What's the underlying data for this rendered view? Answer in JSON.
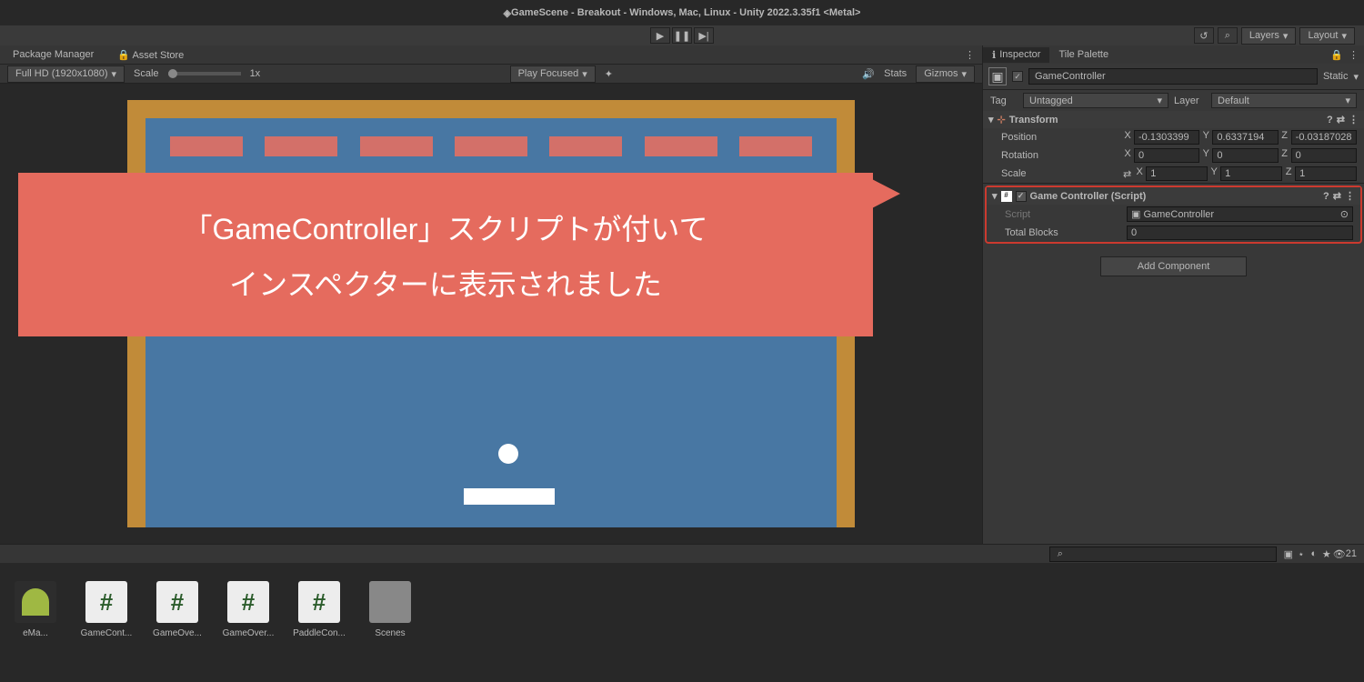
{
  "app": {
    "title": "GameScene - Breakout - Windows, Mac, Linux - Unity 2022.3.35f1 <Metal>"
  },
  "topbar": {
    "layers": "Layers",
    "layout": "Layout"
  },
  "tabs": {
    "package_manager": "Package Manager",
    "asset_store": "Asset Store"
  },
  "scene_toolbar": {
    "resolution": "Full HD (1920x1080)",
    "scale_label": "Scale",
    "scale_value": "1x",
    "play_focused": "Play Focused",
    "stats": "Stats",
    "gizmos": "Gizmos"
  },
  "callout": {
    "line1": "「GameController」スクリプトが付いて",
    "line2": "インスペクターに表示されました"
  },
  "inspector": {
    "tab_inspector": "Inspector",
    "tab_tile_palette": "Tile Palette",
    "object_name": "GameController",
    "static_label": "Static",
    "tag_label": "Tag",
    "tag_value": "Untagged",
    "layer_label": "Layer",
    "layer_value": "Default",
    "transform": {
      "title": "Transform",
      "position_label": "Position",
      "pos_x": "-0.1303399",
      "pos_y": "0.6337194",
      "pos_z": "-0.03187028",
      "rotation_label": "Rotation",
      "rot_x": "0",
      "rot_y": "0",
      "rot_z": "0",
      "scale_label": "Scale",
      "scl_x": "1",
      "scl_y": "1",
      "scl_z": "1"
    },
    "script_comp": {
      "title": "Game Controller (Script)",
      "script_label": "Script",
      "script_value": "GameController",
      "total_blocks_label": "Total Blocks",
      "total_blocks_value": "0"
    },
    "add_component": "Add Component"
  },
  "project": {
    "items": [
      "eMa...",
      "GameCont...",
      "GameOve...",
      "GameOver...",
      "PaddleCon...",
      "Scenes"
    ],
    "visible_count": "21"
  }
}
